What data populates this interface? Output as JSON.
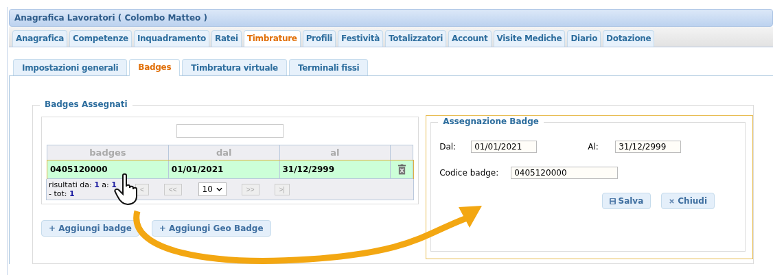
{
  "window": {
    "title": "Anagrafica Lavoratori ( Colombo Matteo )"
  },
  "tabs": [
    {
      "label": "Anagrafica",
      "selected": false
    },
    {
      "label": "Competenze",
      "selected": false
    },
    {
      "label": "Inquadramento",
      "selected": false
    },
    {
      "label": "Ratei",
      "selected": false
    },
    {
      "label": "Timbrature",
      "selected": true
    },
    {
      "label": "Profili",
      "selected": false
    },
    {
      "label": "Festività",
      "selected": false
    },
    {
      "label": "Totalizzatori",
      "selected": false
    },
    {
      "label": "Account",
      "selected": false
    },
    {
      "label": "Visite Mediche",
      "selected": false
    },
    {
      "label": "Diario",
      "selected": false
    },
    {
      "label": "Dotazione",
      "selected": false
    }
  ],
  "subtabs": [
    {
      "label": "Impostazioni generali",
      "selected": false
    },
    {
      "label": "Badges",
      "selected": true
    },
    {
      "label": "Timbratura virtuale",
      "selected": false
    },
    {
      "label": "Terminali fissi",
      "selected": false
    }
  ],
  "badges_panel": {
    "title": "Badges Assegnati",
    "table": {
      "columns": [
        "badges",
        "dal",
        "al"
      ],
      "rows": [
        {
          "cells": [
            "0405120000",
            "01/01/2021",
            "31/12/2999"
          ],
          "selected": true
        }
      ]
    },
    "pager": {
      "summary": "risultati da: **1** a: **1** - tot: **1**",
      "buttons": [
        "<",
        "<<",
        ">>",
        ">|"
      ],
      "page_size": "10"
    },
    "buttons": [
      "+ Aggiungi badge",
      "+ Aggiungi Geo Badge"
    ]
  },
  "form": {
    "title": "Assegnazione Badge",
    "fields": [
      {
        "label": "Dal:",
        "value": "01/01/2021"
      },
      {
        "label": "Al:",
        "value": "31/12/2999"
      },
      {
        "label": "Codice badge:",
        "value": "0405120000"
      }
    ],
    "buttons": [
      {
        "label": "Salva",
        "kind": "save"
      },
      {
        "label": "Chiudi",
        "kind": "close"
      }
    ]
  }
}
